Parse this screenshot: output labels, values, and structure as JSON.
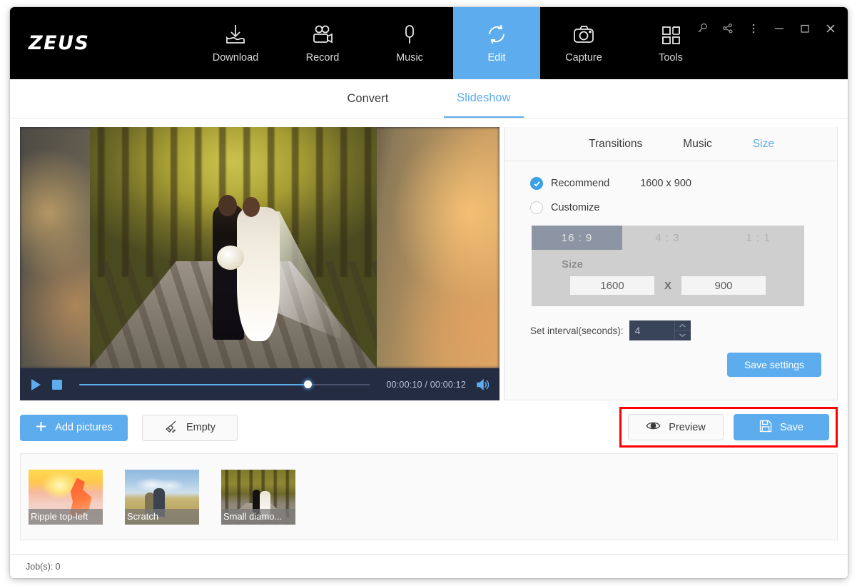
{
  "window": {
    "logo": "ZEUS",
    "controls": [
      {
        "name": "key-icon",
        "label": "Key"
      },
      {
        "name": "share-icon",
        "label": "Share"
      },
      {
        "name": "more-vertical-icon",
        "label": "More"
      },
      {
        "name": "minimize-icon",
        "label": "Minimize"
      },
      {
        "name": "maximize-icon",
        "label": "Maximize"
      },
      {
        "name": "close-icon",
        "label": "Close"
      }
    ]
  },
  "nav": {
    "items": [
      {
        "label": "Download",
        "icon": "download-icon",
        "active": false
      },
      {
        "label": "Record",
        "icon": "video-camera-icon",
        "active": false
      },
      {
        "label": "Music",
        "icon": "microphone-icon",
        "active": false
      },
      {
        "label": "Edit",
        "icon": "refresh-icon",
        "active": true
      },
      {
        "label": "Capture",
        "icon": "camera-icon",
        "active": false
      },
      {
        "label": "Tools",
        "icon": "grid-icon",
        "active": false
      }
    ]
  },
  "subtabs": {
    "convert": "Convert",
    "slideshow": "Slideshow"
  },
  "player": {
    "play_icon": "play-icon",
    "stop_icon": "stop-icon",
    "volume_icon": "volume-icon",
    "time": "00:00:10 / 00:00:12",
    "current_time": "00:00:10",
    "total_time": "00:00:12",
    "progress_percent": 78.5
  },
  "panel": {
    "tabs": [
      {
        "label": "Transitions",
        "active": false
      },
      {
        "label": "Music",
        "active": false
      },
      {
        "label": "Size",
        "active": true
      }
    ],
    "recommend": {
      "label": "Recommend",
      "value": "1600 x 900",
      "selected": true
    },
    "customize": {
      "label": "Customize",
      "selected": false
    },
    "ratios": [
      {
        "label": "16 : 9",
        "active": true
      },
      {
        "label": "4 : 3",
        "active": false
      },
      {
        "label": "1 : 1",
        "active": false
      }
    ],
    "size": {
      "title": "Size",
      "width": "1600",
      "height": "900",
      "separator": "X"
    },
    "interval": {
      "label": "Set interval(seconds):",
      "value": "4"
    },
    "save_settings_label": "Save settings"
  },
  "actions": {
    "add_pictures": "Add pictures",
    "empty": "Empty",
    "preview": "Preview",
    "save": "Save",
    "highlight_color": "#ff0000"
  },
  "thumbnails": [
    {
      "caption": "Ripple top-left"
    },
    {
      "caption": "Scratch"
    },
    {
      "caption": "Small diamo..."
    }
  ],
  "statusbar": {
    "jobs": "Job(s): 0"
  },
  "colors": {
    "accent": "#5cacee",
    "header_bg": "#000000",
    "player_bg": "#232c41",
    "highlight": "#ff0000"
  }
}
